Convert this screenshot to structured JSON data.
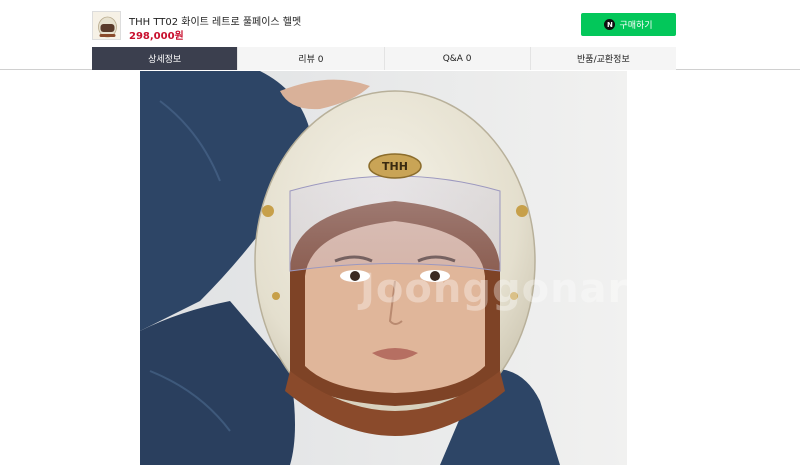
{
  "product": {
    "title": "THH TT02 화이트 레트로 풀페이스 헬멧",
    "price": "298,000원",
    "thumbnail_icon": "helmet-thumbnail"
  },
  "buy_button": {
    "badge": "N",
    "label": "구매하기",
    "color": "#03c75a"
  },
  "tabs": [
    {
      "label": "상세정보",
      "active": true
    },
    {
      "label": "리뷰 0",
      "active": false
    },
    {
      "label": "Q&A 0",
      "active": false
    },
    {
      "label": "반품/교환정보",
      "active": false
    }
  ],
  "detail_image": {
    "helmet_logo": "THH",
    "watermark": "Joonggonara"
  },
  "colors": {
    "price": "#c8102e",
    "active_tab": "#3b3f4e",
    "helmet_shell": "#e6e2d3",
    "helmet_trim": "#8a4a2b"
  }
}
